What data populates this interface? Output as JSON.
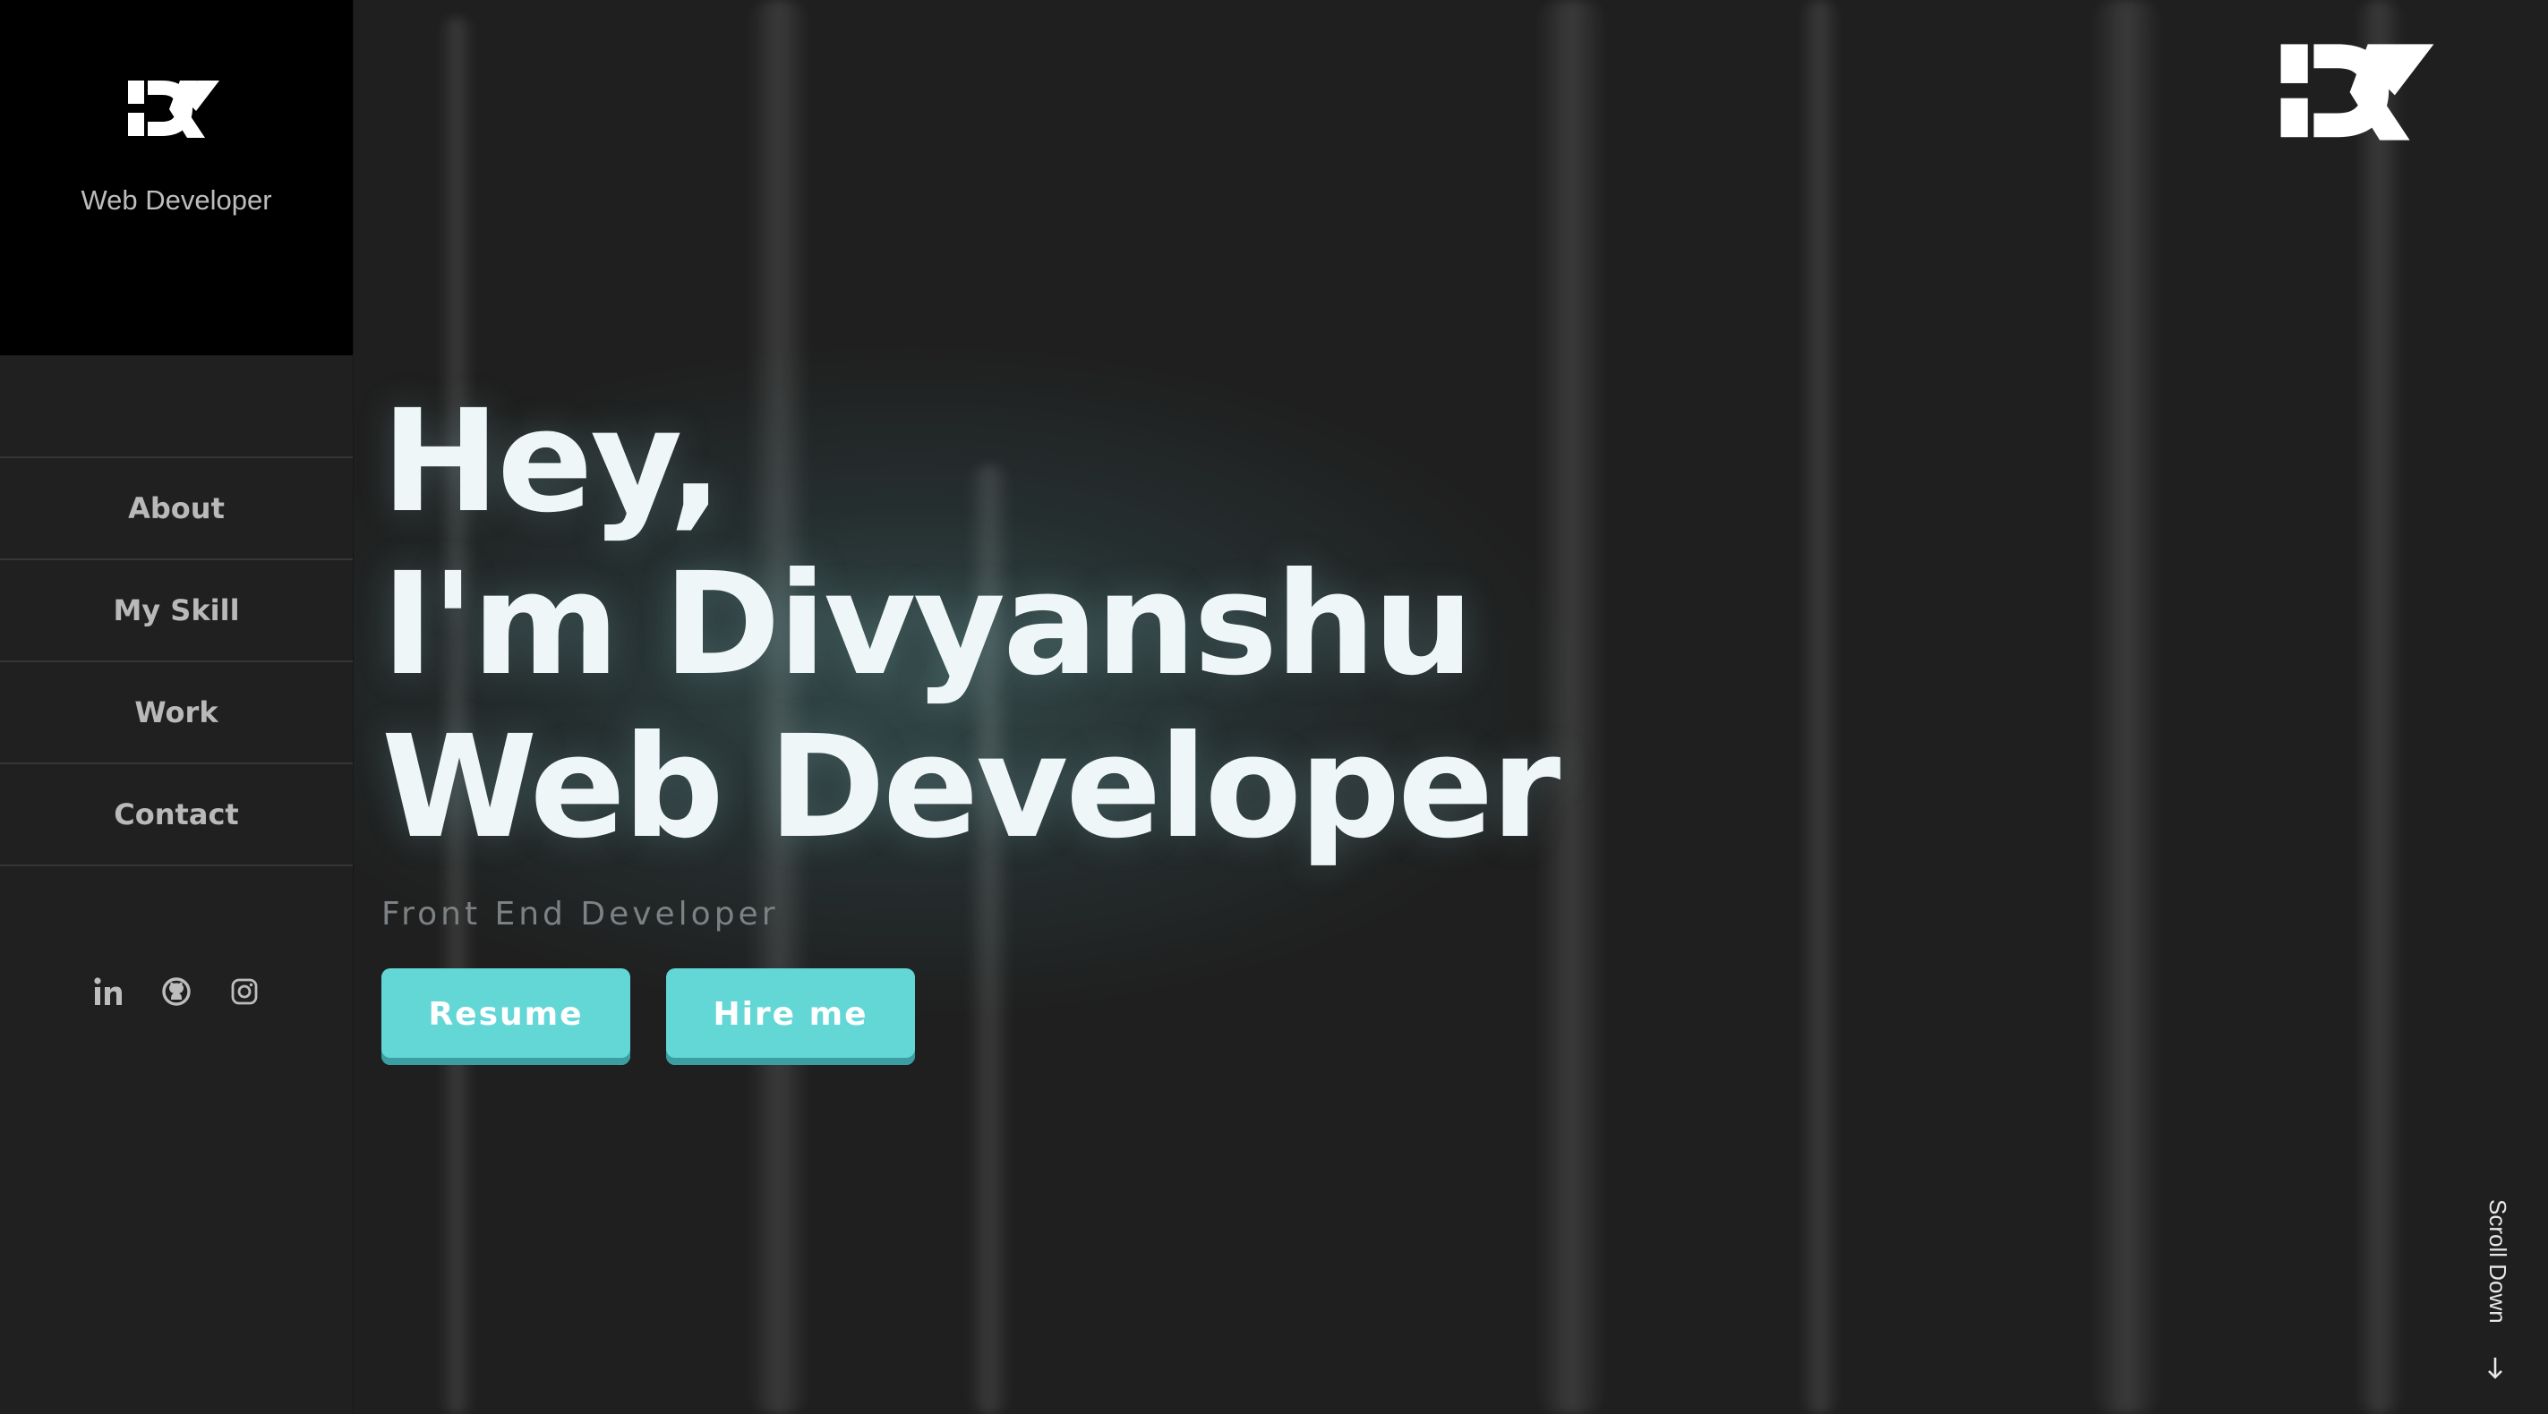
{
  "brand": {
    "logo_text": "DK",
    "subtitle": "Web Developer"
  },
  "nav": {
    "items": [
      {
        "label": "About"
      },
      {
        "label": "My Skill"
      },
      {
        "label": "Work"
      },
      {
        "label": "Contact"
      }
    ]
  },
  "socials": [
    {
      "icon": "linkedin-icon"
    },
    {
      "icon": "github-icon"
    },
    {
      "icon": "instagram-icon"
    }
  ],
  "hero": {
    "line1": "Hey,",
    "line2": "I'm Divyanshu",
    "line3": "Web Developer",
    "subtitle": "Front End Developer",
    "resume_label": "Resume",
    "hire_label": "Hire me"
  },
  "scroll": {
    "label": "Scroll Down",
    "icon": "arrow-down-icon"
  },
  "colors": {
    "background": "#1f1f1f",
    "sidebar": "#202020",
    "brand_panel": "#000000",
    "accent": "#63d6d6",
    "hero_text": "#eef6f8",
    "muted": "#7b8184"
  }
}
